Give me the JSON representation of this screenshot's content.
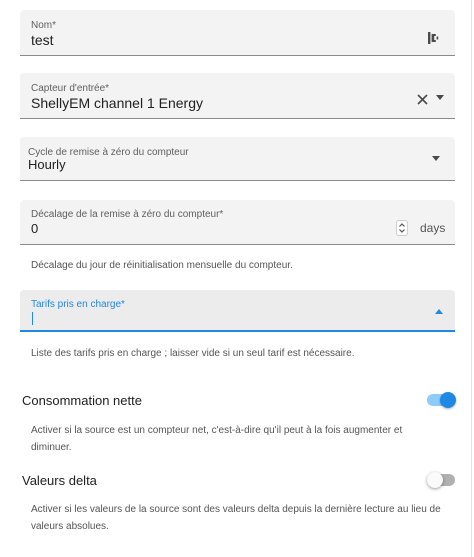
{
  "fields": {
    "name": {
      "label": "Nom*",
      "value": "test"
    },
    "input_sensor": {
      "label": "Capteur d'entrée*",
      "value": "ShellyEM channel 1 Energy"
    },
    "reset_cycle": {
      "label": "Cycle de remise à zéro du compteur",
      "value": "Hourly"
    },
    "reset_offset": {
      "label": "Décalage de la remise à zéro du compteur*",
      "value": "0",
      "unit": "days",
      "helper": "Décalage du jour de réinitialisation mensuelle du compteur."
    },
    "tariffs": {
      "label": "Tarifs pris en charge*",
      "value": "",
      "helper": "Liste des tarifs pris en charge ; laisser vide si un seul tarif est nécessaire."
    }
  },
  "net_consumption": {
    "title": "Consommation nette",
    "description": "Activer si la source est un compteur net, c'est-à-dire qu'il peut à la fois augmenter et diminuer.",
    "enabled": true
  },
  "delta_values": {
    "title": "Valeurs delta",
    "description": "Activer si les valeurs de la source sont des valeurs delta depuis la dernière lecture au lieu de valeurs absolues.",
    "enabled": false
  },
  "colors": {
    "accent": "#1e88e5",
    "field_bg": "#f3f3f3",
    "toggle_on_track": "#90caf9",
    "toggle_off_track": "#b0b0b0",
    "toggle_off_thumb": "#fafafa"
  },
  "icons": {
    "name_field": "entity-id-icon",
    "clear": "close-icon",
    "dropdown": "chevron-down-icon",
    "stepper": "stepper-arrows-icon"
  }
}
